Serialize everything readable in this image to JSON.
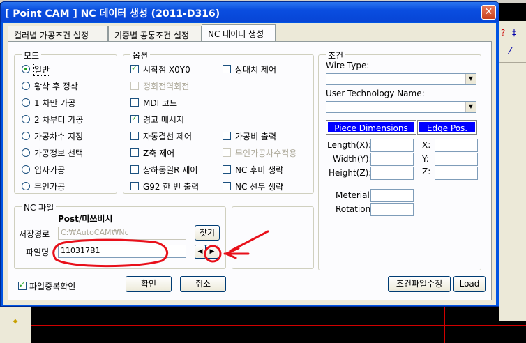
{
  "window": {
    "title": "[ Point CAM ]   NC 데이터 생성   (2011-D316)",
    "close_label": "✕"
  },
  "tabs": [
    {
      "label": "컬러별 가공조건 설정"
    },
    {
      "label": "기종별 공통조건 설정"
    },
    {
      "label": "NC 데이터 생성"
    }
  ],
  "mode": {
    "title": "모드",
    "options": [
      "일반",
      "황삭 후 정삭",
      "1 차만 가공",
      "2 차부터 가공",
      "가공차수 지정",
      "가공정보 선택",
      "입자가공",
      "무인가공"
    ],
    "selected": "일반"
  },
  "options": {
    "title": "옵션",
    "left": [
      {
        "label": "시작점 X0Y0",
        "checked": true,
        "disabled": false
      },
      {
        "label": "정회전역회전",
        "checked": false,
        "disabled": true
      },
      {
        "label": "MDI 코드",
        "checked": false,
        "disabled": false
      },
      {
        "label": "경고 메시지",
        "checked": true,
        "disabled": false
      },
      {
        "label": "자동결선 제어",
        "checked": false,
        "disabled": false
      },
      {
        "label": "Z축 제어",
        "checked": false,
        "disabled": false
      },
      {
        "label": "상하동일R 제어",
        "checked": false,
        "disabled": false
      },
      {
        "label": "G92 한 번 출력",
        "checked": false,
        "disabled": false
      }
    ],
    "right": [
      {
        "label": "상대치 제어",
        "checked": false,
        "disabled": false
      },
      {
        "label": "가공비 출력",
        "checked": false,
        "disabled": false
      },
      {
        "label": "무인가공차수적용",
        "checked": false,
        "disabled": true
      },
      {
        "label": "NC 후미 생략",
        "checked": false,
        "disabled": false
      },
      {
        "label": "NC 선두 생략",
        "checked": false,
        "disabled": false
      }
    ]
  },
  "condition": {
    "title": "조건",
    "wire_type_label": "Wire Type:",
    "wire_type_value": "",
    "user_tech_label": "User Technology Name:",
    "user_tech_value": "",
    "piece_dim_header": "Piece Dimensions",
    "edge_pos_header": "Edge Pos.",
    "length_label": "Length(X):",
    "width_label": "Width(Y):",
    "height_label": "Height(Z):",
    "x_label": "X:",
    "y_label": "Y:",
    "z_label": "Z:",
    "material_label": "Meterial:",
    "rotation_label": "Rotation:"
  },
  "nc_file": {
    "title": "NC 파일",
    "post_name": "Post/미쓰비시",
    "save_path_label": "저장경로",
    "save_path_value": "C:₩AutoCAM₩Nc",
    "browse_label": "찾기",
    "file_name_label": "파일명",
    "file_name_value": "110317B1",
    "prev_arrow": "◀",
    "next_arrow": "▶"
  },
  "footer": {
    "dup_check_label": "파일중복확인",
    "dup_check_checked": true,
    "ok_label": "확인",
    "cancel_label": "취소",
    "edit_condition_label": "조건파일수정",
    "load_label": "Load"
  },
  "colors": {
    "annotation": "#e8101a",
    "title_bar": "#0054e3",
    "header_blue": "#0000ff"
  }
}
